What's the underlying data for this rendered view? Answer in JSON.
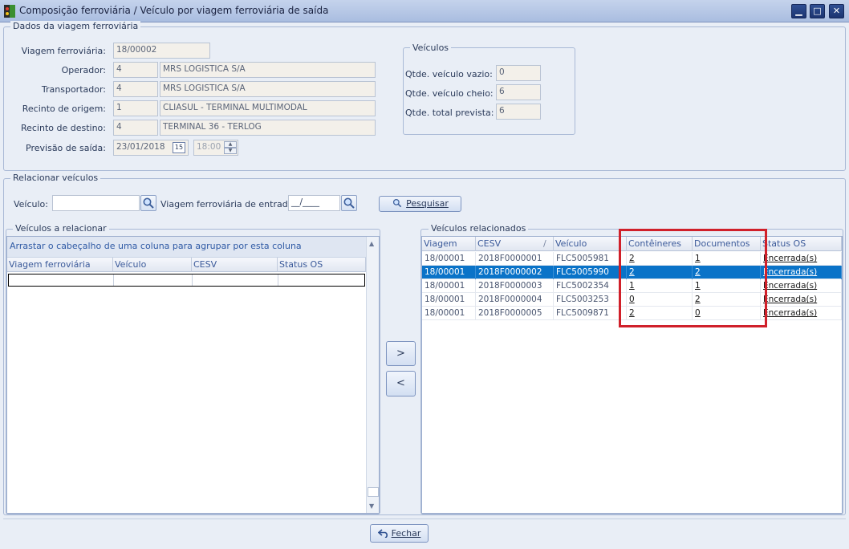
{
  "window": {
    "title": "Composição ferroviária / Veículo por viagem ferroviária de saída",
    "min_glyph": "▁",
    "max_glyph": "□",
    "close_glyph": "✕"
  },
  "dados": {
    "legend": "Dados da viagem ferroviária",
    "viagem_label": "Viagem ferroviária:",
    "viagem_value": "18/00002",
    "operador_label": "Operador:",
    "operador_code": "4",
    "operador_name": "MRS LOGISTICA S/A",
    "transportador_label": "Transportador:",
    "transportador_code": "4",
    "transportador_name": "MRS LOGISTICA S/A",
    "origem_label": "Recinto de origem:",
    "origem_code": "1",
    "origem_name": "CLIASUL - TERMINAL MULTIMODAL",
    "destino_label": "Recinto de destino:",
    "destino_code": "4",
    "destino_name": "TERMINAL 36 - TERLOG",
    "previsao_label": "Previsão de saída:",
    "previsao_date": "23/01/2018",
    "calendar_glyph": "15",
    "previsao_time": "18:00"
  },
  "veiculos_box": {
    "legend": "Veículos",
    "vazio_label": "Qtde. veículo vazio:",
    "vazio_value": "0",
    "cheio_label": "Qtde. veículo cheio:",
    "cheio_value": "6",
    "total_label": "Qtde. total prevista:",
    "total_value": "6"
  },
  "relacionar": {
    "legend": "Relacionar veículos",
    "veiculo_label": "Veículo:",
    "veiculo_value": "",
    "entrada_label": "Viagem ferroviária de entrada:",
    "entrada_value": "__/____",
    "pesquisar_label": "Pesquisar"
  },
  "a_relacionar": {
    "legend": "Veículos a relacionar",
    "group_hint": "Arrastar o cabeçalho de uma coluna para agrupar por esta coluna",
    "columns": [
      "Viagem ferroviária",
      "Veículo",
      "CESV",
      "Status OS"
    ]
  },
  "transfer": {
    "add_label": ">",
    "remove_label": "<"
  },
  "relacionados": {
    "legend": "Veículos relacionados",
    "columns": [
      "Viagem",
      "CESV",
      "Veículo",
      "Contêineres",
      "Documentos",
      "Status OS"
    ],
    "sort_glyph": "/",
    "rows": [
      {
        "viagem": "18/00001",
        "cesv": "2018F0000001",
        "veiculo": "FLC5005981",
        "conteineres": "2",
        "documentos": "1",
        "status": "Encerrada(s)"
      },
      {
        "viagem": "18/00001",
        "cesv": "2018F0000002",
        "veiculo": "FLC5005990",
        "conteineres": "2",
        "documentos": "2",
        "status": "Encerrada(s)"
      },
      {
        "viagem": "18/00001",
        "cesv": "2018F0000003",
        "veiculo": "FLC5002354",
        "conteineres": "1",
        "documentos": "1",
        "status": "Encerrada(s)"
      },
      {
        "viagem": "18/00001",
        "cesv": "2018F0000004",
        "veiculo": "FLC5003253",
        "conteineres": "0",
        "documentos": "2",
        "status": "Encerrada(s)"
      },
      {
        "viagem": "18/00001",
        "cesv": "2018F0000005",
        "veiculo": "FLC5009871",
        "conteineres": "2",
        "documentos": "0",
        "status": "Encerrada(s)"
      }
    ],
    "selected_row": 1
  },
  "footer": {
    "fechar_label": "Fechar"
  },
  "colors": {
    "selection": "#0a73c8",
    "highlight": "#d0202a",
    "titlebar": "#a9bde0"
  }
}
